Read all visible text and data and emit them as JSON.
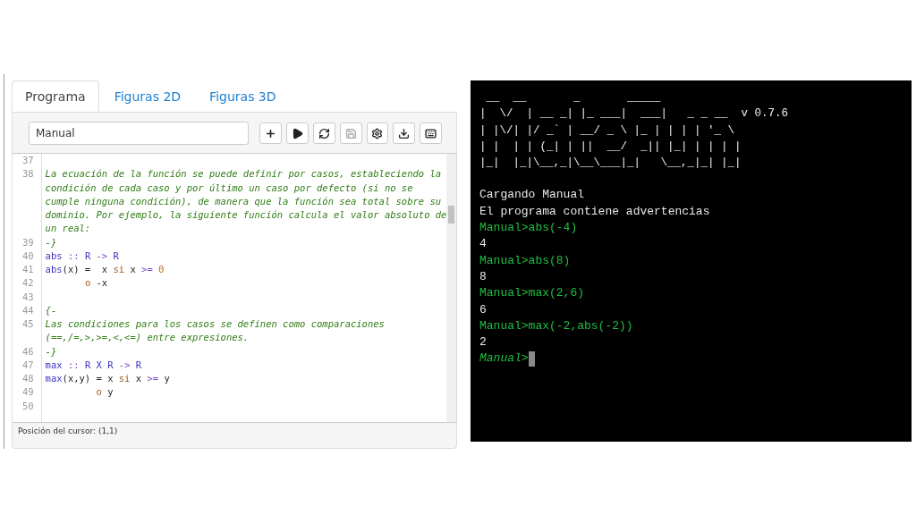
{
  "tabs": [
    {
      "label": "Programa",
      "selected": true
    },
    {
      "label": "Figuras 2D",
      "selected": false
    },
    {
      "label": "Figuras 3D",
      "selected": false
    }
  ],
  "toolbar": {
    "program_name": "Manual",
    "buttons": [
      {
        "kind": "new",
        "disabled": false
      },
      {
        "kind": "run",
        "disabled": false
      },
      {
        "kind": "reload",
        "disabled": false
      },
      {
        "kind": "save",
        "disabled": true
      },
      {
        "kind": "settings",
        "disabled": false
      },
      {
        "kind": "download",
        "disabled": false
      },
      {
        "kind": "keyboard",
        "disabled": false
      }
    ]
  },
  "editor": {
    "lines": [
      {
        "number": "37",
        "rows": [
          []
        ]
      },
      {
        "number": "38",
        "rows": [
          [
            {
              "kind": "comment",
              "text": "La ecuación de la función se puede definir por casos, estableciendo la"
            }
          ],
          [
            {
              "kind": "comment",
              "text": "condición de cada caso y por último un caso por defecto (si no se"
            }
          ],
          [
            {
              "kind": "comment",
              "text": "cumple ninguna condición), de manera que la función sea total sobre su"
            }
          ],
          [
            {
              "kind": "comment",
              "text": "dominio. Por ejemplo, la siguiente función calcula el valor absoluto de"
            }
          ],
          [
            {
              "kind": "comment",
              "text": "un real:"
            }
          ]
        ]
      },
      {
        "number": "39",
        "rows": [
          [
            {
              "kind": "comment",
              "text": "-}"
            }
          ]
        ]
      },
      {
        "number": "40",
        "rows": [
          [
            {
              "kind": "name",
              "text": "abs"
            },
            {
              "kind": "operator",
              "text": " :: "
            },
            {
              "kind": "type",
              "text": "R"
            },
            {
              "kind": "operator",
              "text": " -> "
            },
            {
              "kind": "type",
              "text": "R"
            }
          ]
        ]
      },
      {
        "number": "41",
        "rows": [
          [
            {
              "kind": "name",
              "text": "abs"
            },
            {
              "kind": "plain",
              "text": "(x) =  x "
            },
            {
              "kind": "keyword",
              "text": "si"
            },
            {
              "kind": "plain",
              "text": " x "
            },
            {
              "kind": "operator",
              "text": ">="
            },
            {
              "kind": "plain",
              "text": " "
            },
            {
              "kind": "number",
              "text": "0"
            }
          ]
        ]
      },
      {
        "number": "42",
        "rows": [
          [
            {
              "kind": "plain",
              "text": "       "
            },
            {
              "kind": "keyword",
              "text": "o"
            },
            {
              "kind": "plain",
              "text": " -x"
            }
          ]
        ]
      },
      {
        "number": "43",
        "rows": [
          []
        ]
      },
      {
        "number": "44",
        "rows": [
          [
            {
              "kind": "comment",
              "text": "{-"
            }
          ]
        ]
      },
      {
        "number": "45",
        "rows": [
          [
            {
              "kind": "comment",
              "text": "Las condiciones para los casos se definen como comparaciones"
            }
          ],
          [
            {
              "kind": "comment",
              "text": "(==,/=,>,>=,<,<=) entre expresiones."
            }
          ]
        ]
      },
      {
        "number": "46",
        "rows": [
          [
            {
              "kind": "comment",
              "text": "-}"
            }
          ]
        ]
      },
      {
        "number": "47",
        "rows": [
          [
            {
              "kind": "name",
              "text": "max"
            },
            {
              "kind": "operator",
              "text": " :: "
            },
            {
              "kind": "type",
              "text": "R X R"
            },
            {
              "kind": "operator",
              "text": " -> "
            },
            {
              "kind": "type",
              "text": "R"
            }
          ]
        ]
      },
      {
        "number": "48",
        "rows": [
          [
            {
              "kind": "name",
              "text": "max"
            },
            {
              "kind": "plain",
              "text": "(x,y) = x "
            },
            {
              "kind": "keyword",
              "text": "si"
            },
            {
              "kind": "plain",
              "text": " x "
            },
            {
              "kind": "operator",
              "text": ">="
            },
            {
              "kind": "plain",
              "text": " y"
            }
          ]
        ]
      },
      {
        "number": "49",
        "rows": [
          [
            {
              "kind": "plain",
              "text": "         "
            },
            {
              "kind": "keyword",
              "text": "o"
            },
            {
              "kind": "plain",
              "text": " y"
            }
          ]
        ]
      },
      {
        "number": "50",
        "rows": [
          []
        ]
      }
    ]
  },
  "status_bar": "Posición del cursor: (1,1)",
  "terminal": {
    "banner": [
      " __  __       _       _____",
      "|  \\/  | __ _| |_ ___|  ___|   _ _ __",
      "| |\\/| |/ _` | __/ _ \\ |_ | | | | '_ \\",
      "| |  | | (_| | ||  __/  _|| |_| | | | |",
      "|_|  |_|\\__,_|\\__\\___|_|   \\__,_|_| |_|"
    ],
    "version": "v 0.7.6",
    "lines": [
      {
        "kind": "output",
        "text": "Cargando Manual"
      },
      {
        "kind": "output",
        "text": "El programa contiene advertencias"
      },
      {
        "kind": "input",
        "text": "Manual>abs(-4)"
      },
      {
        "kind": "output",
        "text": "4"
      },
      {
        "kind": "input",
        "text": "Manual>abs(8)"
      },
      {
        "kind": "output",
        "text": "8"
      },
      {
        "kind": "input",
        "text": "Manual>max(2,6)"
      },
      {
        "kind": "output",
        "text": "6"
      },
      {
        "kind": "input",
        "text": "Manual>max(-2,abs(-2))"
      },
      {
        "kind": "output",
        "text": "2"
      },
      {
        "kind": "prompt",
        "text": "Manual>"
      }
    ]
  }
}
